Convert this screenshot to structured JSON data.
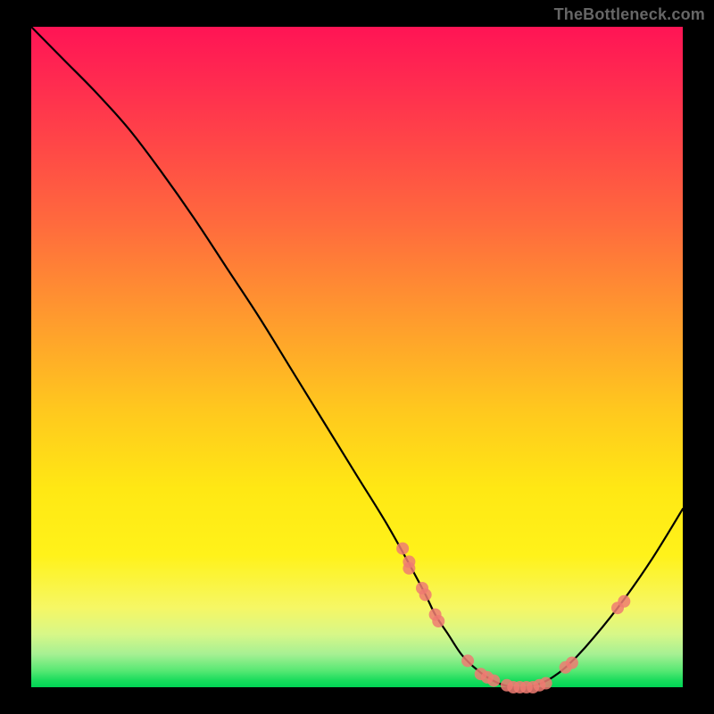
{
  "watermark": "TheBottleneck.com",
  "chart_data": {
    "type": "line",
    "title": "",
    "xlabel": "",
    "ylabel": "",
    "xlim": [
      0,
      100
    ],
    "ylim": [
      0,
      100
    ],
    "x": [
      0,
      5,
      10,
      15,
      20,
      25,
      30,
      35,
      40,
      45,
      50,
      55,
      60,
      62,
      64,
      66,
      68,
      70,
      72,
      74,
      76,
      78,
      80,
      82,
      85,
      90,
      95,
      100
    ],
    "values": [
      100,
      95,
      90,
      84.5,
      78,
      71,
      63.5,
      56,
      48,
      40,
      32,
      24,
      15,
      11,
      8,
      5,
      3,
      1.5,
      0.5,
      0,
      0,
      0.5,
      1.5,
      3,
      6,
      12,
      19,
      27
    ],
    "markers_x": [
      57,
      58,
      58,
      60,
      60.5,
      62,
      62.5,
      67,
      69,
      70,
      71,
      73,
      74,
      75,
      76,
      77,
      78,
      79,
      82,
      83,
      90,
      91
    ],
    "markers_y": [
      21,
      19,
      18,
      15,
      14,
      11,
      10,
      4,
      2,
      1.5,
      1,
      0.3,
      0,
      0,
      0,
      0,
      0.3,
      0.6,
      3,
      3.7,
      12,
      13
    ],
    "gradient_stops": [
      {
        "pos": 0,
        "color": "#ff1455"
      },
      {
        "pos": 50,
        "color": "#ffc81e"
      },
      {
        "pos": 80,
        "color": "#fff21a"
      },
      {
        "pos": 100,
        "color": "#00d455"
      }
    ]
  }
}
